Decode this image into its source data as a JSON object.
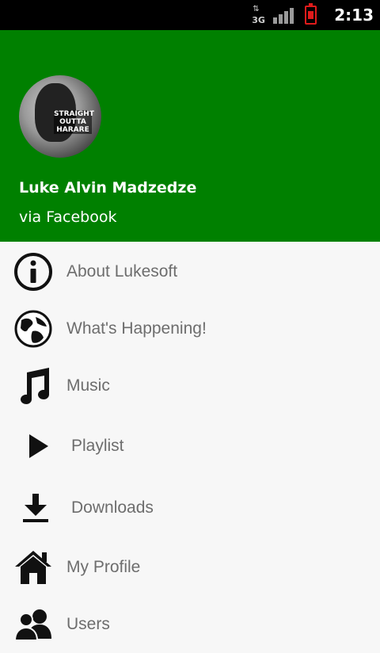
{
  "status_bar": {
    "network_type": "3G",
    "time": "2:13",
    "battery_color": "#e01b1b"
  },
  "header": {
    "background_color": "#008000",
    "avatar_shirt_text": "STRAIGHT OUTTA HARARE",
    "user_name": "Luke Alvin Madzedze",
    "source": "via Facebook"
  },
  "menu": {
    "items": [
      {
        "label": "About Lukesoft",
        "icon": "info-icon"
      },
      {
        "label": "What's Happening!",
        "icon": "globe-icon"
      },
      {
        "label": "Music",
        "icon": "music-note-icon"
      },
      {
        "label": "Playlist",
        "icon": "play-icon"
      },
      {
        "label": "Downloads",
        "icon": "download-icon"
      },
      {
        "label": "My Profile",
        "icon": "home-icon"
      },
      {
        "label": "Users",
        "icon": "users-icon"
      }
    ]
  }
}
